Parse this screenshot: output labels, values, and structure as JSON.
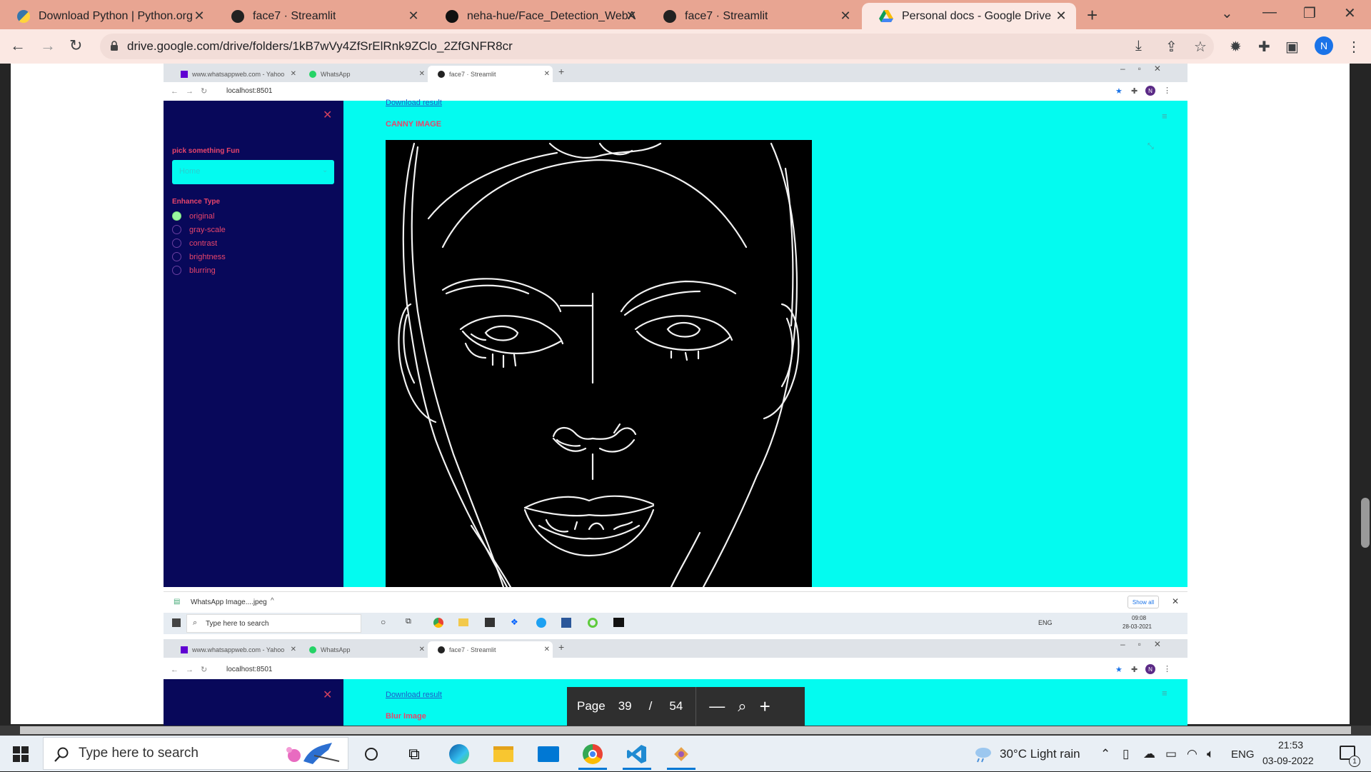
{
  "browser": {
    "tabs": [
      {
        "title": "Download Python | Python.org",
        "favicon": "python-icon",
        "active": false
      },
      {
        "title": "face7 · Streamlit",
        "favicon": "streamlit-icon",
        "active": false
      },
      {
        "title": "neha-hue/Face_Detection_WebA",
        "favicon": "github-icon",
        "active": false
      },
      {
        "title": "face7 · Streamlit",
        "favicon": "streamlit-icon",
        "active": false
      },
      {
        "title": "Personal docs - Google Drive",
        "favicon": "google-drive-icon",
        "active": true
      }
    ],
    "url": "drive.google.com/drive/folders/1kB7wVy4ZfSrElRnk9ZClo_2ZfGNFR8cr",
    "profile_initial": "N"
  },
  "embedded_top": {
    "tabs": [
      "www.whatsappweb.com - Yahoo",
      "WhatsApp",
      "face7 · Streamlit"
    ],
    "url": "localhost:8501",
    "profile_initial": "N",
    "download_link": "Download result",
    "section_title": "CANNY IMAGE",
    "sidebar": {
      "select_label": "pick something Fun",
      "select_value": "Home",
      "enhance_label": "Enhance Type",
      "options": [
        "original",
        "gray-scale",
        "contrast",
        "brightness",
        "blurring"
      ],
      "selected_index": 0
    },
    "download_bar": {
      "file": "WhatsApp Image....jpeg",
      "show_all": "Show all"
    },
    "mini_taskbar": {
      "search": "Type here to search",
      "lang": "ENG",
      "time": "09:08",
      "date": "28-03-2021"
    }
  },
  "embedded_bottom": {
    "tabs": [
      "www.whatsappweb.com - Yahoo",
      "WhatsApp",
      "face7 · Streamlit"
    ],
    "url": "localhost:8501",
    "profile_initial": "N",
    "download_link": "Download result",
    "section_title": "Blur Image"
  },
  "page_control": {
    "label": "Page",
    "current": "39",
    "separator": "/",
    "total": "54"
  },
  "taskbar": {
    "search_placeholder": "Type here to search",
    "weather": "30°C  Light rain",
    "lang": "ENG",
    "time": "21:53",
    "date": "03-09-2022",
    "notification_count": "1"
  },
  "colors": {
    "streamlit_sidebar": "#08085a",
    "streamlit_bg": "#03fbf0",
    "label_pink": "#e8456b",
    "tabbar": "#e8a592"
  }
}
